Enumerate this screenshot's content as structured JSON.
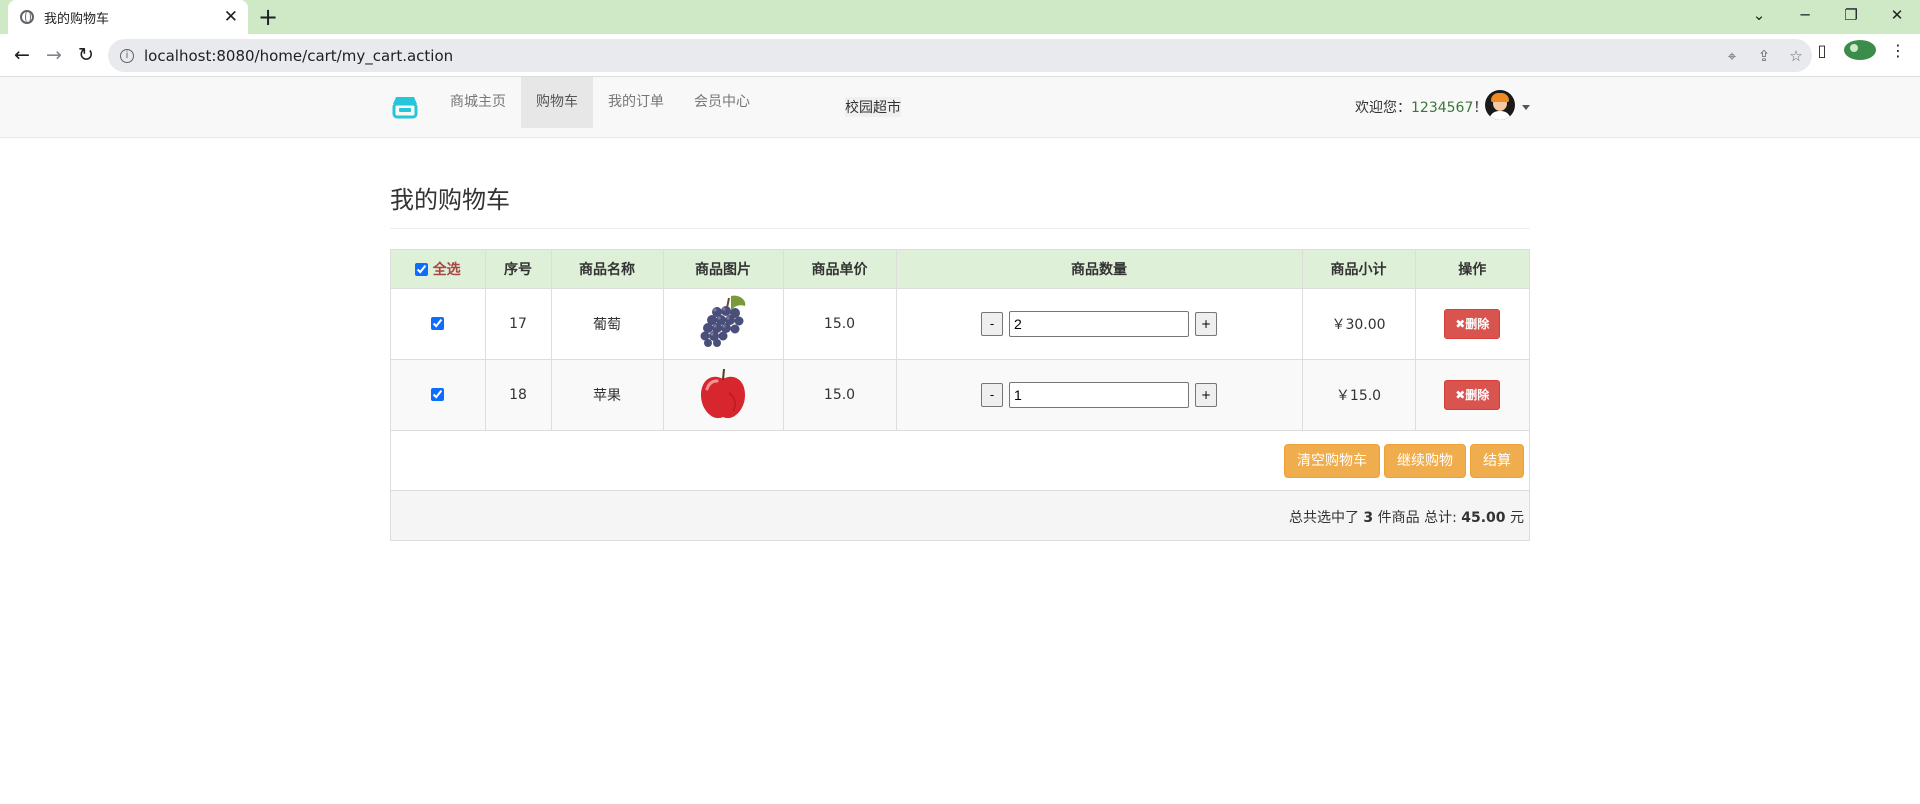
{
  "browser": {
    "tab_title": "我的购物车",
    "url": "localhost:8080/home/cart/my_cart.action"
  },
  "navbar": {
    "items": [
      {
        "label": "商城主页"
      },
      {
        "label": "购物车"
      },
      {
        "label": "我的订单"
      },
      {
        "label": "会员中心"
      }
    ],
    "active_index": 1,
    "site_name": "校园超市",
    "welcome_prefix": "欢迎您：",
    "user_id": "1234567",
    "welcome_suffix": "！"
  },
  "page": {
    "title": "我的购物车"
  },
  "cart": {
    "select_all_label": "全选",
    "select_all_checked": true,
    "headers": [
      "序号",
      "商品名称",
      "商品图片",
      "商品单价",
      "商品数量",
      "商品小计",
      "操作"
    ],
    "rows": [
      {
        "checked": true,
        "id": "17",
        "name": "葡萄",
        "image": "grape-image",
        "price": "15.0",
        "qty": "2",
        "subtotal": "￥30.00"
      },
      {
        "checked": true,
        "id": "18",
        "name": "苹果",
        "image": "apple-image",
        "price": "15.0",
        "qty": "1",
        "subtotal": "￥15.0"
      }
    ],
    "minus_label": "-",
    "plus_label": "+",
    "delete_label": "删除",
    "buttons": {
      "clear": "清空购物车",
      "continue": "继续购物",
      "checkout": "结算"
    },
    "summary": {
      "prefix": "总共选中了",
      "count": "3",
      "middle": "件商品 总计:",
      "total": "45.00",
      "suffix": "元"
    }
  },
  "colors": {
    "header_bg": "#dff0d8",
    "delete_btn": "#d9534f",
    "action_btn": "#f0ad4e",
    "tabstrip": "#cfe8c5"
  }
}
